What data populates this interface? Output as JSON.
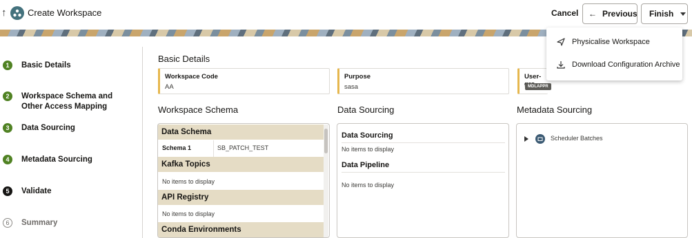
{
  "header": {
    "title": "Create Workspace",
    "cancel_label": "Cancel",
    "previous_label": "Previous",
    "finish_label": "Finish"
  },
  "menu": {
    "items": [
      {
        "label": "Physicalise Workspace",
        "icon": "send-icon"
      },
      {
        "label": "Download Configuration Archive",
        "icon": "download-icon"
      }
    ]
  },
  "steps": [
    {
      "number": "1",
      "label": "Basic Details",
      "state": "done"
    },
    {
      "number": "2",
      "label": "Workspace Schema and Other Access Mapping",
      "state": "done"
    },
    {
      "number": "3",
      "label": "Data Sourcing",
      "state": "done"
    },
    {
      "number": "4",
      "label": "Metadata Sourcing",
      "state": "done"
    },
    {
      "number": "5",
      "label": "Validate",
      "state": "current"
    },
    {
      "number": "6",
      "label": "Summary",
      "state": "todo"
    }
  ],
  "basic_details": {
    "title": "Basic Details",
    "fields": [
      {
        "label": "Workspace Code",
        "value": "AA"
      },
      {
        "label": "Purpose",
        "value": "sasa"
      },
      {
        "label": "User-gro",
        "value": "MDLAPPR"
      }
    ]
  },
  "workspace_schema": {
    "title": "Workspace Schema",
    "data_schema_label": "Data Schema",
    "schema_row": {
      "name": "Schema 1",
      "value": "SB_PATCH_TEST"
    },
    "kafka_label": "Kafka Topics",
    "kafka_empty": "No items to display",
    "api_label": "API Registry",
    "api_empty": "No items to display",
    "conda_label": "Conda Environments"
  },
  "data_sourcing": {
    "title": "Data Sourcing",
    "sourcing_label": "Data Sourcing",
    "sourcing_empty": "No items to display",
    "pipeline_label": "Data Pipeline",
    "pipeline_empty": "No items to display"
  },
  "metadata_sourcing": {
    "title": "Metadata Sourcing",
    "tree_item": "Scheduler Batches"
  },
  "colors": {
    "done_step": "#508223",
    "current_step": "#161513",
    "field_accent": "#e6b74d",
    "band": "#e5dcc5"
  }
}
